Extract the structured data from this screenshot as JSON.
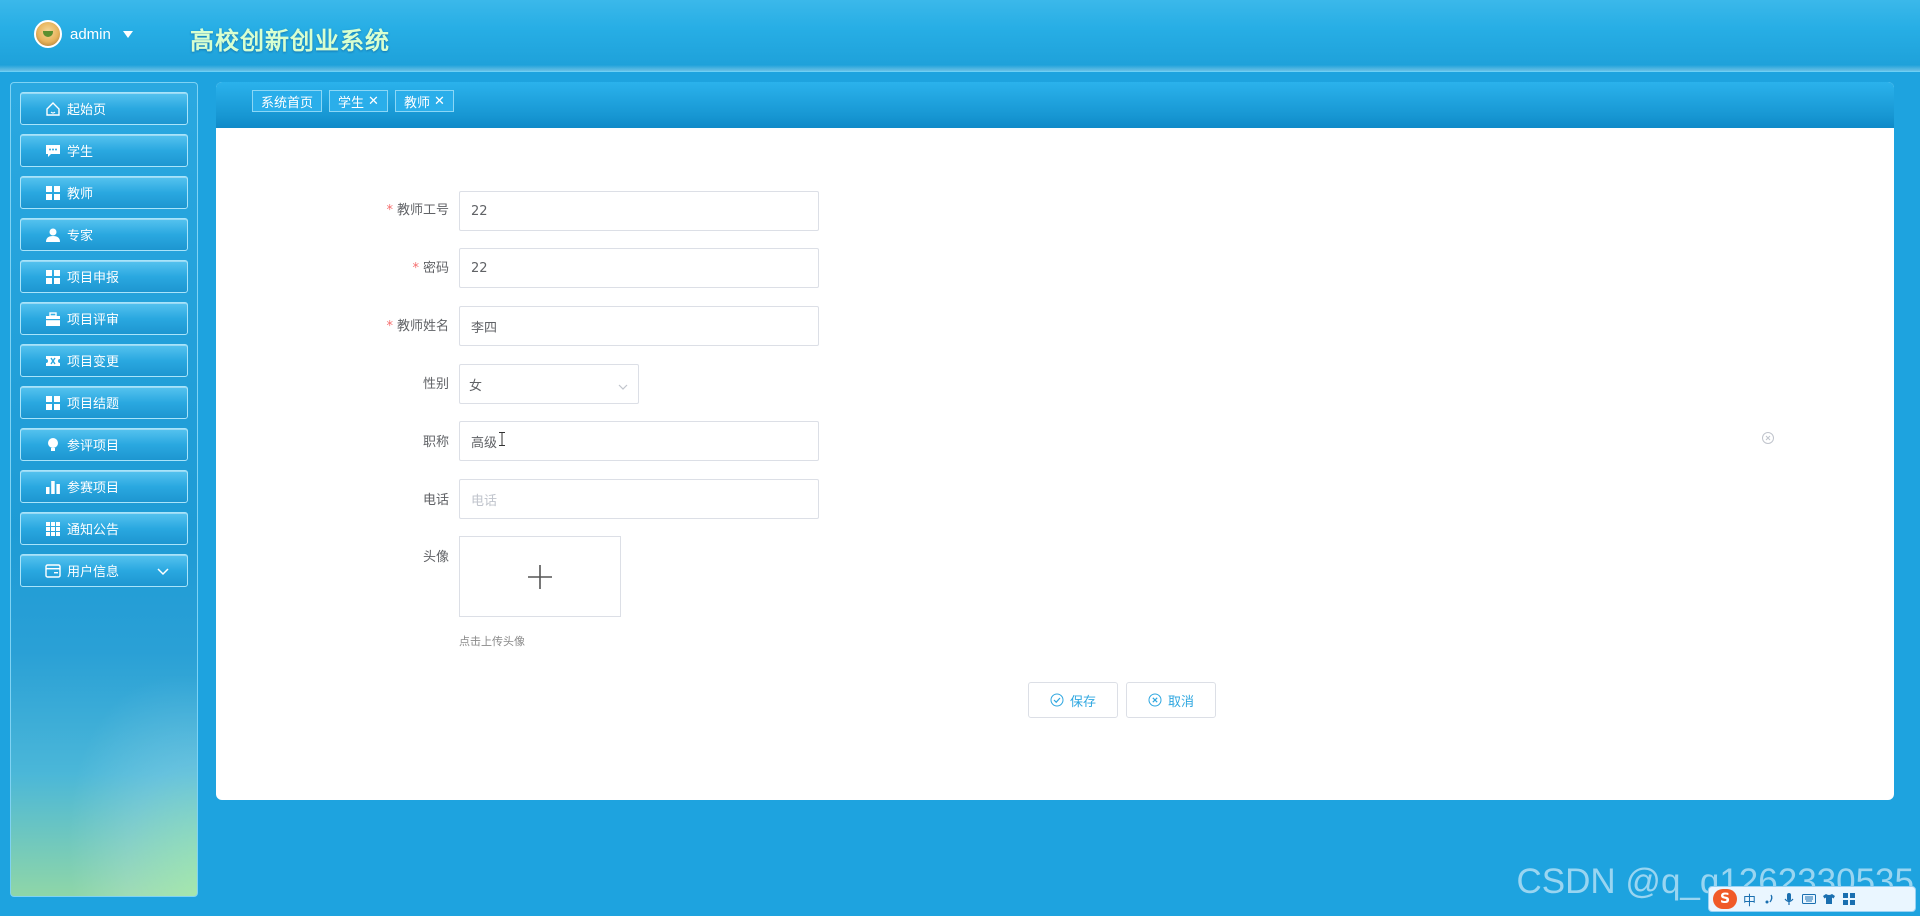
{
  "header": {
    "username": "admin",
    "app_title": "高校创新创业系统"
  },
  "sidebar": {
    "items": [
      {
        "label": "起始页",
        "icon": "home-icon"
      },
      {
        "label": "学生",
        "icon": "chat-icon"
      },
      {
        "label": "教师",
        "icon": "grid-icon"
      },
      {
        "label": "专家",
        "icon": "user-icon"
      },
      {
        "label": "项目申报",
        "icon": "grid-icon"
      },
      {
        "label": "项目评审",
        "icon": "briefcase-icon"
      },
      {
        "label": "项目变更",
        "icon": "ticket-icon"
      },
      {
        "label": "项目结题",
        "icon": "grid-icon"
      },
      {
        "label": "参评项目",
        "icon": "bulb-icon"
      },
      {
        "label": "参赛项目",
        "icon": "bar-chart-icon"
      },
      {
        "label": "通知公告",
        "icon": "apps-icon"
      },
      {
        "label": "用户信息",
        "icon": "card-icon"
      }
    ]
  },
  "tabs": [
    {
      "label": "系统首页",
      "closable": false
    },
    {
      "label": "学生",
      "closable": true,
      "close": "✕"
    },
    {
      "label": "教师",
      "closable": true,
      "close": "✕"
    }
  ],
  "form": {
    "teacher_id": {
      "label": "教师工号",
      "value": "22",
      "required_mark": "*"
    },
    "password": {
      "label": "密码",
      "value": "22",
      "required_mark": "*"
    },
    "teacher_name": {
      "label": "教师姓名",
      "value": "李四",
      "required_mark": "*"
    },
    "gender": {
      "label": "性别",
      "value": "女"
    },
    "title": {
      "label": "职称",
      "value": "高级"
    },
    "phone": {
      "label": "电话",
      "value": "",
      "placeholder": "电话"
    },
    "avatar": {
      "label": "头像",
      "tip": "点击上传头像"
    }
  },
  "actions": {
    "save": "保存",
    "cancel": "取消"
  },
  "watermark": "CSDN @q_q1262330535",
  "ime": {
    "logo": "S",
    "mode": "中"
  }
}
